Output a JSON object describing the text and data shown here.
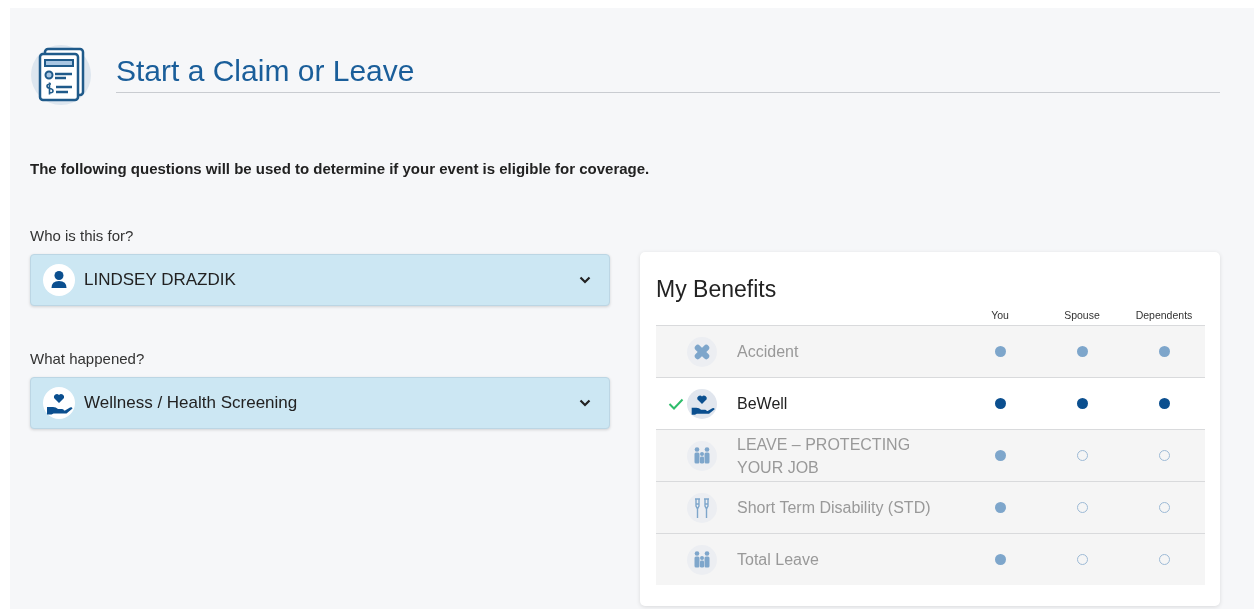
{
  "page": {
    "title": "Start a Claim or Leave",
    "intro": "The following questions will be used to determine if your event is eligible for coverage."
  },
  "questions": [
    {
      "label": "Who is this for?",
      "value": "LINDSEY DRAZDIK"
    },
    {
      "label": "What happened?",
      "value": "Wellness / Health Screening"
    }
  ],
  "benefits": {
    "title": "My Benefits",
    "columns": [
      "You",
      "Spouse",
      "Dependents"
    ],
    "rows": [
      {
        "name": "Accident",
        "selected": false,
        "coverage": [
          true,
          true,
          true
        ]
      },
      {
        "name": "BeWell",
        "selected": true,
        "coverage": [
          true,
          true,
          true
        ]
      },
      {
        "name": "LEAVE – PROTECTING YOUR JOB",
        "selected": false,
        "coverage": [
          true,
          false,
          false
        ]
      },
      {
        "name": "Short Term Disability (STD)",
        "selected": false,
        "coverage": [
          true,
          false,
          false
        ]
      },
      {
        "name": "Total Leave",
        "selected": false,
        "coverage": [
          true,
          false,
          false
        ]
      }
    ]
  }
}
